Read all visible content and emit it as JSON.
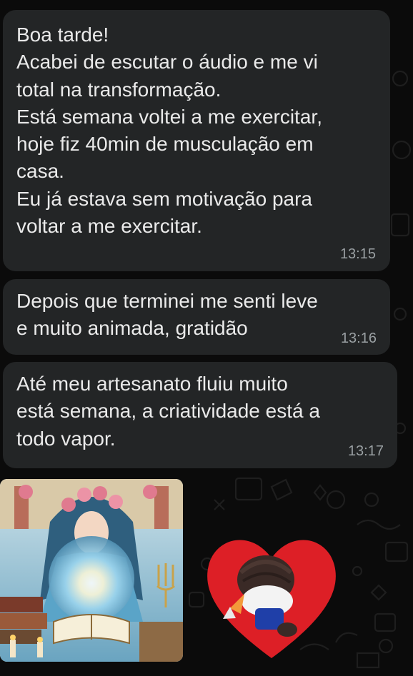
{
  "messages": [
    {
      "text": "Boa tarde!\nAcabei de escutar o áudio e me vi\ntotal na transformação.\nEstá semana voltei a me exercitar,\nhoje fiz 40min de musculação em\ncasa.\nEu já estava sem motivação para\nvoltar a me exercitar.",
      "time": "13:15"
    },
    {
      "text": "Depois que terminei me senti leve\ne muito animada, gratidão",
      "time": "13:16"
    },
    {
      "text": "Até meu artesanato fluiu muito\nestá semana,  a criatividade está a\ntodo vapor.",
      "time": "13:17"
    }
  ],
  "colors": {
    "bubble": "#232526",
    "background": "#0b0b0b",
    "text": "#eaeaea",
    "time": "#9aa0a3",
    "heart": "#dd1f26"
  }
}
